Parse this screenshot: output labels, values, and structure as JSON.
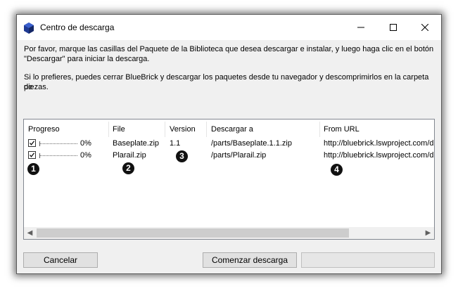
{
  "window": {
    "title": "Centro de descarga",
    "controls": [
      "minimize",
      "maximize",
      "close"
    ]
  },
  "message": {
    "line1": "Por favor, marque las casillas del Paquete de la Biblioteca que desea descargar e instalar, y luego haga clic en el botón",
    "line2": "\"Descargar\" para iniciar la descarga.",
    "line3": "Si lo prefieres, puedes cerrar BlueBrick y descargar los paquetes desde tu navegador y descomprimirlos en la carpeta de",
    "line4": "piezas."
  },
  "table": {
    "columns": [
      "Progreso",
      "File",
      "Version",
      "Descargar a",
      "From URL"
    ],
    "rows": [
      {
        "checked": true,
        "progress": "0%",
        "file": "Baseplate.zip",
        "version": "1.1",
        "dest": "/parts/Baseplate.1.1.zip",
        "url": "http://bluebrick.lswproject.com/d"
      },
      {
        "checked": true,
        "progress": "0%",
        "file": "Plarail.zip",
        "version": "",
        "dest": "/parts/Plarail.zip",
        "url": "http://bluebrick.lswproject.com/d"
      }
    ]
  },
  "annotations": [
    "1",
    "2",
    "3",
    "4"
  ],
  "buttons": {
    "cancel": "Cancelar",
    "start": "Comenzar descarga",
    "third": ""
  },
  "colors": {
    "app_icon": "#1f3a93",
    "titlebar": "#ffffff",
    "dialog_bg": "#f0f0f0"
  }
}
